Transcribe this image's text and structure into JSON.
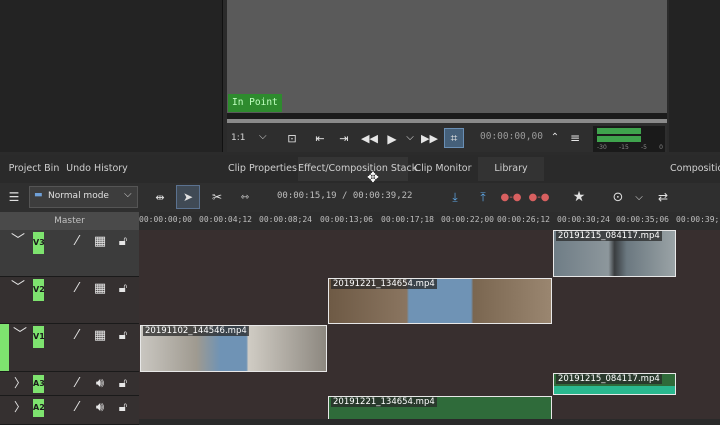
{
  "monitor": {
    "in_point_label": "In Point",
    "zoom_label": "1:1",
    "timecode": "00:00:00,00",
    "audio_meter_labels": [
      "-30",
      "-15",
      "-5",
      "0"
    ]
  },
  "tabs": {
    "project_bin": "Project Bin",
    "undo_history": "Undo History",
    "clip_properties": "Clip Properties",
    "effect_stack": "Effect/Composition Stack",
    "clip_monitor": "Clip Monitor",
    "library": "Library",
    "compositions": "Compositio"
  },
  "toolbar": {
    "edit_mode": "Normal mode",
    "position": "00:00:15,19 / 00:00:39,22"
  },
  "timeline": {
    "master_label": "Master",
    "ruler_labels": [
      "00:00:00;00",
      "00:00:04;12",
      "00:00:08;24",
      "00:00:13;06",
      "00:00:17;18",
      "00:00:22;00",
      "00:00:26;12",
      "00:00:30;24",
      "00:00:35;06",
      "00:00:39;1"
    ],
    "tracks": [
      {
        "tag": "V3",
        "type": "video"
      },
      {
        "tag": "V2",
        "type": "video"
      },
      {
        "tag": "V1",
        "type": "video"
      },
      {
        "tag": "A3",
        "type": "audio"
      },
      {
        "tag": "A2",
        "type": "audio"
      }
    ],
    "clips": {
      "v3_clip": "20191215_084117.mp4",
      "v2_clip": "20191221_134654.mp4",
      "v1_clip": "20191102_144546.mp4",
      "a3_clip": "20191215_084117.mp4",
      "a2_clip": "20191221_134654.mp4"
    }
  },
  "colors": {
    "accent_green": "#7ee36f",
    "in_point_bg": "#2e8b2e",
    "audio_clip_green": "#2f6b3a",
    "timeline_bg": "#382f2f"
  },
  "icons": [
    "settings-sliders-icon",
    "spacer-tool-icon",
    "selection-pointer-icon",
    "razor-icon",
    "slip-tool-icon",
    "insert-icon",
    "overwrite-icon",
    "lift-icon",
    "extract-icon",
    "star-icon",
    "record-icon",
    "chevron-down-icon",
    "mixer-icon",
    "chevron-icon",
    "magic-wand-icon",
    "film-icon",
    "lock-icon",
    "speaker-icon",
    "play-icon",
    "rewind-icon",
    "fast-forward-icon",
    "crop-icon",
    "menu-icon",
    "fullscreen-icon",
    "mark-in-icon",
    "mark-out-icon"
  ]
}
